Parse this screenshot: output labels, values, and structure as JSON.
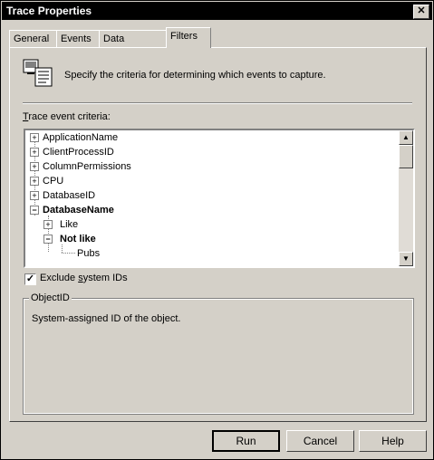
{
  "window": {
    "title": "Trace Properties",
    "close_glyph": "✕"
  },
  "tabs": [
    {
      "label": "General"
    },
    {
      "label": "Events"
    },
    {
      "label": "Data Columns"
    },
    {
      "label": "Filters",
      "active": true
    }
  ],
  "header": {
    "icon": "filter-document-icon",
    "text": "Specify the criteria for determining which events to capture."
  },
  "criteria": {
    "label_accel": "T",
    "label_rest": "race event criteria:",
    "tree": [
      {
        "label": "ApplicationName",
        "expander": "+"
      },
      {
        "label": "ClientProcessID",
        "expander": "+"
      },
      {
        "label": "ColumnPermissions",
        "expander": "+"
      },
      {
        "label": "CPU",
        "expander": "+"
      },
      {
        "label": "DatabaseID",
        "expander": "+"
      },
      {
        "label": "DatabaseName",
        "expander": "−",
        "bold": true
      },
      {
        "label": "Like",
        "expander": "+"
      },
      {
        "label": "Not like",
        "expander": "−",
        "bold": true
      },
      {
        "label": "Pubs"
      }
    ]
  },
  "scrollbar": {
    "up_glyph": "▲",
    "down_glyph": "▼"
  },
  "exclude": {
    "checked": true,
    "check_glyph": "✓",
    "label_pre": "Exclude ",
    "label_accel": "s",
    "label_post": "ystem IDs"
  },
  "group": {
    "title": "ObjectID",
    "description": "System-assigned ID of the object."
  },
  "buttons": {
    "run": "Run",
    "cancel": "Cancel",
    "help": "Help"
  }
}
